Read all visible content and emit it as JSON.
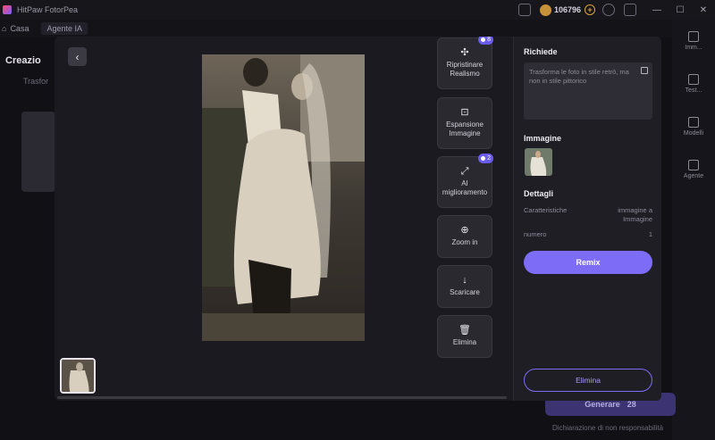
{
  "window": {
    "title": "HitPaw FotorPea",
    "coins": "106796",
    "controls": [
      "—",
      "☐",
      "✕"
    ]
  },
  "nav": {
    "home_label": "Casa",
    "agent_label": "Agente IA"
  },
  "background": {
    "page_title": "Creazio",
    "page_subtitle": "Trasfor",
    "rail": [
      "Imm...",
      "Test...",
      "Modelli",
      "Agente"
    ],
    "generate_label": "Generare",
    "generate_cost": "28",
    "disclaimer": "Dichiarazione di non responsabilità"
  },
  "modal": {
    "back_icon": "‹",
    "tools": [
      {
        "icon": "✣",
        "label": "Ripristinare Realismo",
        "badge": "8"
      },
      {
        "icon": "⊡",
        "label": "Espansione Immagine",
        "badge": ""
      },
      {
        "icon": "⤢",
        "label": "AI miglioramento",
        "badge": "2"
      },
      {
        "icon": "⊕",
        "label": "Zoom in",
        "badge": ""
      },
      {
        "icon": "↓",
        "label": "Scaricare",
        "badge": ""
      },
      {
        "icon": "🗑",
        "label": "Elimina",
        "badge": ""
      }
    ],
    "panel": {
      "prompt_heading": "Richiede",
      "prompt_text": "Trasforma le foto in stile retrò, ma non in stile pittorico",
      "image_heading": "Immagine",
      "details_heading": "Dettagli",
      "details": [
        {
          "key": "Caratteristiche",
          "value": "immagine a Immagine"
        },
        {
          "key": "numero",
          "value": "1"
        }
      ],
      "remix_label": "Remix",
      "delete_label": "Elimina"
    }
  },
  "colors": {
    "accent": "#7d6cf5",
    "modal_bg": "#1b1a20",
    "panel_bg": "#1f1e25"
  }
}
